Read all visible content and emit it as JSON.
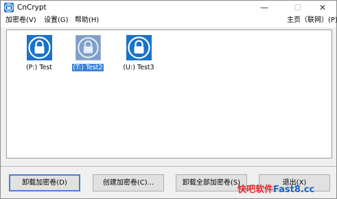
{
  "window": {
    "title": "CnCrypt",
    "min_glyph": "—",
    "max_glyph": "☐",
    "close_glyph": "✕"
  },
  "menu": {
    "encrypt": "加密卷(V)",
    "settings": "设置(G)",
    "help": "帮助(H)",
    "home": "主页（联网）(P)"
  },
  "volumes": [
    {
      "label": "(P:) Test",
      "selected": false
    },
    {
      "label": "(T:) Test2",
      "selected": true
    },
    {
      "label": "(U:) Test3",
      "selected": false
    }
  ],
  "buttons": {
    "dismount": "卸载加密卷(D)",
    "create": "创建加密卷(C)...",
    "dismount_all": "卸载全部加密卷(S)",
    "exit": "退出(X)"
  },
  "watermark": {
    "cn": "快吧软件",
    "en": "Fast8.cc"
  },
  "colors": {
    "icon_blue": "#1a73c9",
    "selected_icon": "#7f9fc8",
    "selection_text_bg": "#3a83d6",
    "watermark_red": "#e3262c",
    "watermark_blue": "#1b64c4"
  },
  "icons": {
    "app": "lock-icon",
    "volume": "lock-icon"
  }
}
